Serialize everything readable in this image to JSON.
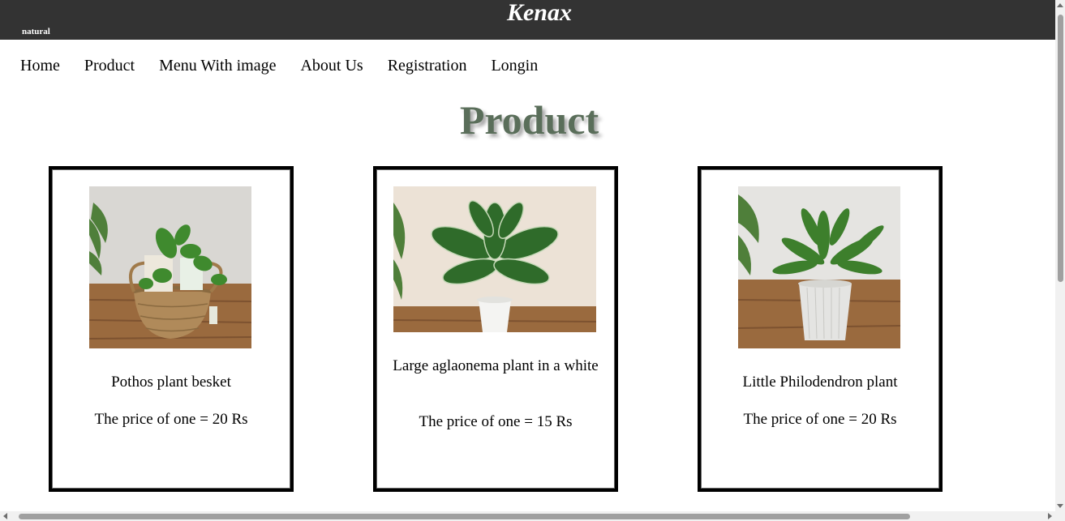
{
  "header": {
    "brand": "Kenax",
    "tagline": "natural",
    "background_color": "#333333"
  },
  "nav": {
    "items": [
      {
        "label": "Home"
      },
      {
        "label": "Product"
      },
      {
        "label": "Menu With image"
      },
      {
        "label": "About Us"
      },
      {
        "label": "Registration"
      },
      {
        "label": "Longin"
      }
    ]
  },
  "page": {
    "title": "Product",
    "title_color": "#5a6e5a"
  },
  "products": [
    {
      "name": "Pothos plant besket",
      "price": "The price of one = 20 Rs",
      "image": "pothos-basket-photo"
    },
    {
      "name": "Large aglaonema plant in a white",
      "price": "The price of one = 15 Rs",
      "image": "aglaonema-white-pot-photo"
    },
    {
      "name": "Little Philodendron plant",
      "price": "The price of one = 20 Rs",
      "image": "philodendron-pot-photo"
    }
  ]
}
